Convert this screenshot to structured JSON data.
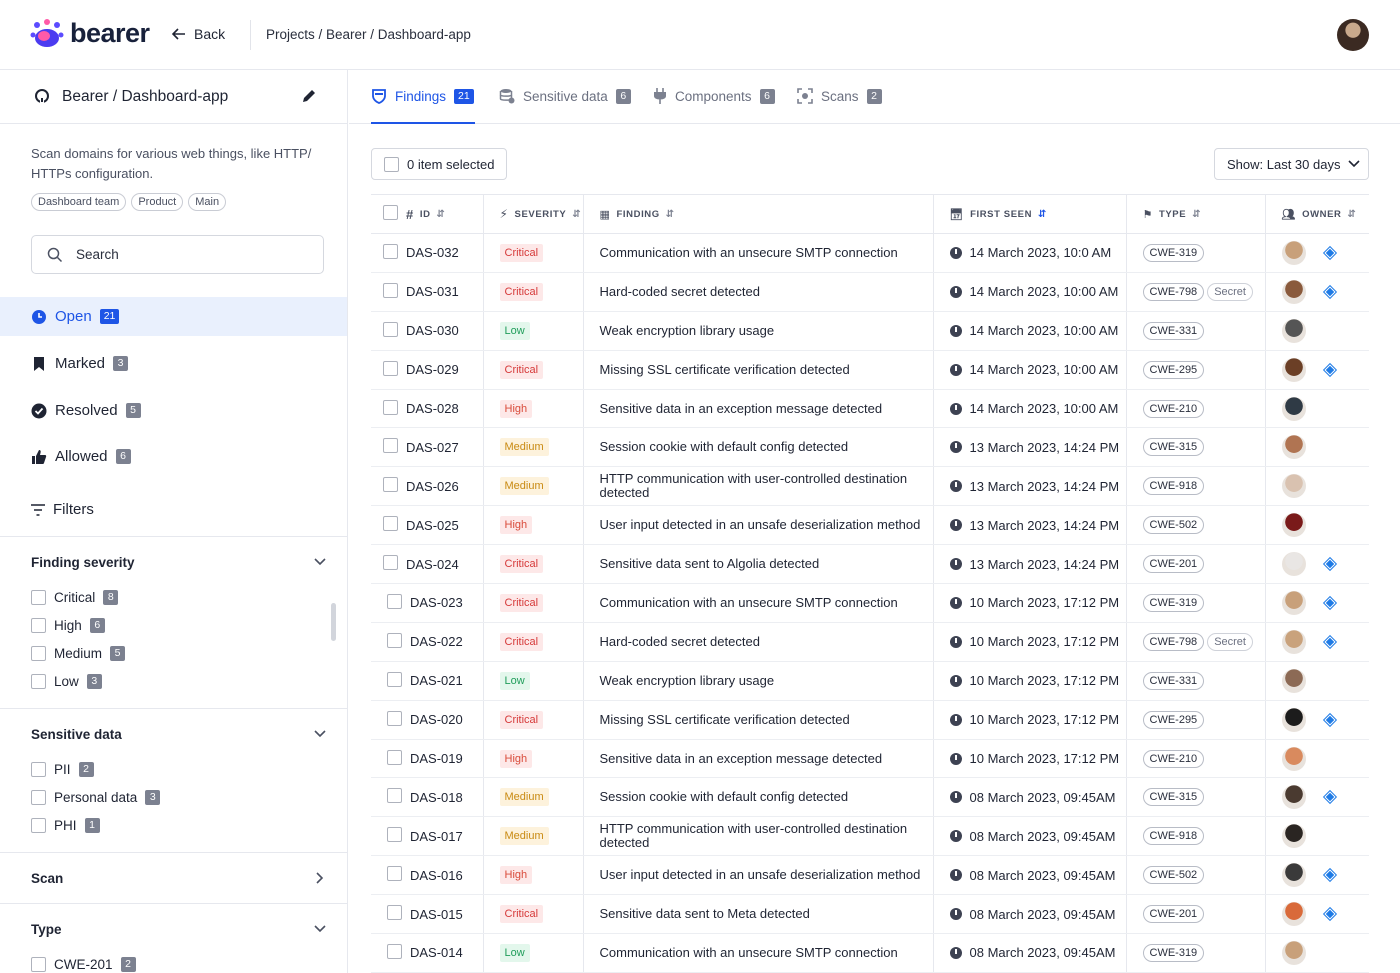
{
  "topbar": {
    "logo": "bearer",
    "back_label": "Back",
    "breadcrumb": "Projects / Bearer / Dashboard-app"
  },
  "sidebar": {
    "repo_title": "Bearer / Dashboard-app",
    "description": "Scan domains for various web things, like HTTP/ HTTPs configuration.",
    "tags": [
      "Dashboard team",
      "Product",
      "Main"
    ],
    "search_placeholder": "Search",
    "statuses": [
      {
        "label": "Open",
        "count": "21"
      },
      {
        "label": "Marked",
        "count": "3"
      },
      {
        "label": "Resolved",
        "count": "5"
      },
      {
        "label": "Allowed",
        "count": "6"
      }
    ],
    "filters_label": "Filters",
    "sections": {
      "severity": {
        "title": "Finding severity",
        "items": [
          {
            "label": "Critical",
            "count": "8"
          },
          {
            "label": "High",
            "count": "6"
          },
          {
            "label": "Medium",
            "count": "5"
          },
          {
            "label": "Low",
            "count": "3"
          }
        ]
      },
      "sensitive": {
        "title": "Sensitive data",
        "items": [
          {
            "label": "PII",
            "count": "2"
          },
          {
            "label": "Personal data",
            "count": "3"
          },
          {
            "label": "PHI",
            "count": "1"
          }
        ]
      },
      "scan": {
        "title": "Scan"
      },
      "type": {
        "title": "Type",
        "items": [
          {
            "label": "CWE-201",
            "count": "2"
          }
        ]
      }
    }
  },
  "tabs": [
    {
      "label": "Findings",
      "count": "21"
    },
    {
      "label": "Sensitive data",
      "count": "6"
    },
    {
      "label": "Components",
      "count": "6"
    },
    {
      "label": "Scans",
      "count": "2"
    }
  ],
  "toolbar": {
    "selected_label": "0 item selected",
    "show_label": "Show: Last 30 days"
  },
  "table": {
    "headers": {
      "id": "ID",
      "severity": "SEVERITY",
      "finding": "FINDING",
      "first_seen": "FIRST SEEN",
      "type": "TYPE",
      "owner": "OWNER"
    },
    "rows": [
      {
        "id": "DAS-032",
        "severity": "Critical",
        "finding": "Communication with an unsecure SMTP connection",
        "first_seen": "14 March 2023, 10:0 AM",
        "type": "CWE-319",
        "secret": "",
        "av": "#c8a07a"
      },
      {
        "id": "DAS-031",
        "severity": "Critical",
        "finding": "Hard-coded secret detected",
        "first_seen": "14 March 2023, 10:00 AM",
        "type": "CWE-798",
        "secret": "Secret",
        "av": "#8a5a3c"
      },
      {
        "id": "DAS-030",
        "severity": "Low",
        "finding": "Weak encryption library usage",
        "first_seen": "14 March 2023, 10:00 AM",
        "type": "CWE-331",
        "secret": "",
        "av": "#555555"
      },
      {
        "id": "DAS-029",
        "severity": "Critical",
        "finding": "Missing SSL certificate verification detected",
        "first_seen": "14 March 2023, 10:00 AM",
        "type": "CWE-295",
        "secret": "",
        "av": "#6b3f26"
      },
      {
        "id": "DAS-028",
        "severity": "High",
        "finding": "Sensitive data in an exception message detected",
        "first_seen": "14 March 2023, 10:00 AM",
        "type": "CWE-210",
        "secret": "",
        "av": "#2f3a45"
      },
      {
        "id": "DAS-027",
        "severity": "Medium",
        "finding": "Session cookie with default config detected",
        "first_seen": "13 March 2023, 14:24 PM",
        "type": "CWE-315",
        "secret": "",
        "av": "#b07452"
      },
      {
        "id": "DAS-026",
        "severity": "Medium",
        "finding": "HTTP communication with user-controlled destination detected",
        "first_seen": "13 March 2023, 14:24 PM",
        "type": "CWE-918",
        "secret": "",
        "av": "#d9c2b0"
      },
      {
        "id": "DAS-025",
        "severity": "High",
        "finding": "User input detected in an unsafe deserialization method",
        "first_seen": "13 March 2023, 14:24 PM",
        "type": "CWE-502",
        "secret": "",
        "av": "#7a1a1a"
      },
      {
        "id": "DAS-024",
        "severity": "Critical",
        "finding": "Sensitive data sent to Algolia detected",
        "first_seen": "13 March 2023, 14:24 PM",
        "type": "CWE-201",
        "secret": "",
        "av": "#e9e6e4"
      },
      {
        "id": "DAS-023",
        "severity": "Critical",
        "finding": "Communication with an unsecure SMTP connection",
        "first_seen": "10 March 2023, 17:12 PM",
        "type": "CWE-319",
        "secret": "",
        "av": "#c8a07a"
      },
      {
        "id": "DAS-022",
        "severity": "Critical",
        "finding": "Hard-coded secret detected",
        "first_seen": "10 March 2023, 17:12 PM",
        "type": "CWE-798",
        "secret": "Secret",
        "av": "#c9a27c"
      },
      {
        "id": "DAS-021",
        "severity": "Low",
        "finding": "Weak encryption library usage",
        "first_seen": "10 March 2023, 17:12 PM",
        "type": "CWE-331",
        "secret": "",
        "av": "#8c6a55"
      },
      {
        "id": "DAS-020",
        "severity": "Critical",
        "finding": "Missing SSL certificate verification detected",
        "first_seen": "10 March 2023, 17:12 PM",
        "type": "CWE-295",
        "secret": "",
        "av": "#1c1c1c"
      },
      {
        "id": "DAS-019",
        "severity": "High",
        "finding": "Sensitive data in an exception message detected",
        "first_seen": "10 March 2023, 17:12 PM",
        "type": "CWE-210",
        "secret": "",
        "av": "#d98a5e"
      },
      {
        "id": "DAS-018",
        "severity": "Medium",
        "finding": "Session cookie with default config detected",
        "first_seen": "08 March 2023, 09:45AM",
        "type": "CWE-315",
        "secret": "",
        "av": "#4a3a30"
      },
      {
        "id": "DAS-017",
        "severity": "Medium",
        "finding": "HTTP communication with user-controlled destination detected",
        "first_seen": "08 March 2023, 09:45AM",
        "type": "CWE-918",
        "secret": "",
        "av": "#2a2522"
      },
      {
        "id": "DAS-016",
        "severity": "High",
        "finding": "User input detected in an unsafe deserialization method",
        "first_seen": "08 March 2023, 09:45AM",
        "type": "CWE-502",
        "secret": "",
        "av": "#3a3a3a"
      },
      {
        "id": "DAS-015",
        "severity": "Critical",
        "finding": "Sensitive data sent to Meta detected",
        "first_seen": "08 March 2023, 09:45AM",
        "type": "CWE-201",
        "secret": "",
        "av": "#d96a3a"
      },
      {
        "id": "DAS-014",
        "severity": "Low",
        "finding": "Communication with an unsecure SMTP connection",
        "first_seen": "08 March 2023, 09:45AM",
        "type": "CWE-319",
        "secret": "",
        "av": "#c8a07a"
      }
    ]
  },
  "colors": {
    "accent": "#1e55e6",
    "diamond": "#1e7be6"
  },
  "owner_badge_rows": [
    "DAS-032",
    "DAS-031",
    "DAS-029",
    "DAS-024",
    "DAS-023",
    "DAS-022",
    "DAS-020",
    "DAS-018",
    "DAS-016",
    "DAS-015"
  ]
}
